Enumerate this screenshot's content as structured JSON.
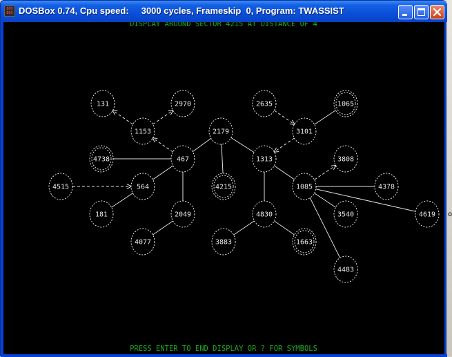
{
  "window": {
    "title": "DOSBox 0.74, Cpu speed:     3000 cycles, Frameskip  0, Program: TWASSIST",
    "icon_text": "DOS BOX"
  },
  "titlebar_buttons": [
    "minimize-icon",
    "maximize-icon",
    "close-icon"
  ],
  "screen": {
    "header": "DISPLAY AROUND SECTOR 4215 AT DISTANCE OF 4",
    "footer": "PRESS ENTER TO END DISPLAY OR ? FOR SYMBOLS"
  },
  "colors": {
    "screen_bg": "#000000",
    "text_green": "#1fa81f",
    "node": "#e8e8e8",
    "title_bar": "#0a4fd8"
  },
  "sectors": [
    {
      "id": "131",
      "style": "normal"
    },
    {
      "id": "2970",
      "style": "normal"
    },
    {
      "id": "1153",
      "style": "normal"
    },
    {
      "id": "2179",
      "style": "normal"
    },
    {
      "id": "2635",
      "style": "normal"
    },
    {
      "id": "1065",
      "style": "double"
    },
    {
      "id": "3101",
      "style": "normal"
    },
    {
      "id": "4738",
      "style": "double"
    },
    {
      "id": "467",
      "style": "normal"
    },
    {
      "id": "1313",
      "style": "normal"
    },
    {
      "id": "3808",
      "style": "normal"
    },
    {
      "id": "4515",
      "style": "normal"
    },
    {
      "id": "564",
      "style": "normal"
    },
    {
      "id": "4215",
      "style": "current"
    },
    {
      "id": "1085",
      "style": "normal"
    },
    {
      "id": "4378",
      "style": "normal"
    },
    {
      "id": "181",
      "style": "normal"
    },
    {
      "id": "2049",
      "style": "normal"
    },
    {
      "id": "4830",
      "style": "normal"
    },
    {
      "id": "3540",
      "style": "normal"
    },
    {
      "id": "4619",
      "style": "normal"
    },
    {
      "id": "4077",
      "style": "normal"
    },
    {
      "id": "3883",
      "style": "normal"
    },
    {
      "id": "1663",
      "style": "double"
    },
    {
      "id": "4483",
      "style": "normal"
    }
  ],
  "warps": [
    {
      "from": "1153",
      "to": "131",
      "type": "one-way"
    },
    {
      "from": "1153",
      "to": "2970",
      "type": "one-way"
    },
    {
      "from": "467",
      "to": "1153",
      "type": "one-way"
    },
    {
      "from": "467",
      "to": "2179",
      "type": "two-way"
    },
    {
      "from": "467",
      "to": "4738",
      "type": "two-way"
    },
    {
      "from": "467",
      "to": "564",
      "type": "two-way"
    },
    {
      "from": "467",
      "to": "2049",
      "type": "two-way"
    },
    {
      "from": "2179",
      "to": "4215",
      "type": "two-way"
    },
    {
      "from": "2179",
      "to": "1313",
      "type": "two-way"
    },
    {
      "from": "2635",
      "to": "3101",
      "type": "one-way"
    },
    {
      "from": "3101",
      "to": "1065",
      "type": "two-way"
    },
    {
      "from": "3101",
      "to": "1313",
      "type": "one-way"
    },
    {
      "from": "1313",
      "to": "1085",
      "type": "two-way"
    },
    {
      "from": "1313",
      "to": "4830",
      "type": "two-way"
    },
    {
      "from": "4515",
      "to": "564",
      "type": "one-way"
    },
    {
      "from": "564",
      "to": "181",
      "type": "two-way"
    },
    {
      "from": "2049",
      "to": "4077",
      "type": "two-way"
    },
    {
      "from": "1085",
      "to": "3808",
      "type": "one-way"
    },
    {
      "from": "1085",
      "to": "4378",
      "type": "two-way"
    },
    {
      "from": "1085",
      "to": "3540",
      "type": "two-way"
    },
    {
      "from": "1085",
      "to": "4619",
      "type": "two-way"
    },
    {
      "from": "1085",
      "to": "4483",
      "type": "two-way"
    },
    {
      "from": "4830",
      "to": "3883",
      "type": "two-way"
    },
    {
      "from": "4830",
      "to": "1663",
      "type": "two-way"
    }
  ],
  "right_edge_text": "o"
}
